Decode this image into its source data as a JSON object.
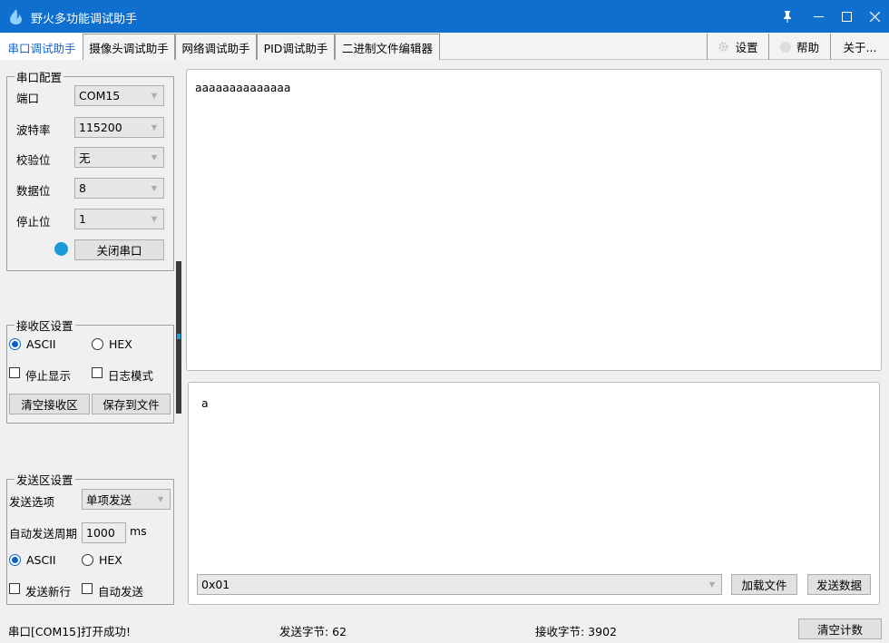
{
  "window": {
    "title": "野火多功能调试助手",
    "controls": [
      "pin-icon",
      "minimize-icon",
      "maximize-icon",
      "close-icon"
    ]
  },
  "tabs": [
    {
      "label": "串口调试助手",
      "active": true
    },
    {
      "label": "摄像头调试助手",
      "active": false
    },
    {
      "label": "网络调试助手",
      "active": false
    },
    {
      "label": "PID调试助手",
      "active": false
    },
    {
      "label": "二进制文件编辑器",
      "active": false
    }
  ],
  "toolbar": {
    "settings_label": "设置",
    "help_label": "帮助",
    "about_label": "关于..."
  },
  "serial_config": {
    "legend": "串口配置",
    "port_label": "端口",
    "port_value": "COM15",
    "baud_label": "波特率",
    "baud_value": "115200",
    "parity_label": "校验位",
    "parity_value": "无",
    "databits_label": "数据位",
    "databits_value": "8",
    "stopbits_label": "停止位",
    "stopbits_value": "1",
    "toggle_button": "关闭串口",
    "led_color": "#1b9bd8"
  },
  "receive_settings": {
    "legend": "接收区设置",
    "ascii_label": "ASCII",
    "hex_label": "HEX",
    "mode": "ASCII",
    "stop_display_label": "停止显示",
    "log_mode_label": "日志模式",
    "clear_button": "清空接收区",
    "save_button": "保存到文件"
  },
  "send_settings": {
    "legend": "发送区设置",
    "option_label": "发送选项",
    "option_value": "单项发送",
    "period_label": "自动发送周期",
    "period_value": "1000",
    "period_unit": "ms",
    "ascii_label": "ASCII",
    "hex_label": "HEX",
    "mode": "ASCII",
    "newline_label": "发送新行",
    "auto_send_label": "自动发送"
  },
  "receive_area": {
    "text": "aaaaaaaaaaaaaa"
  },
  "send_area": {
    "text": "a",
    "history_value": "0x01",
    "load_file_button": "加载文件",
    "send_button": "发送数据"
  },
  "status": {
    "message": "串口[COM15]打开成功!",
    "sent_bytes": "发送字节: 62",
    "received_bytes": "接收字节: 3902",
    "clear_count_button": "清空计数"
  },
  "colors": {
    "titlebar": "#0f6fcf",
    "accent": "#1a66c8"
  }
}
